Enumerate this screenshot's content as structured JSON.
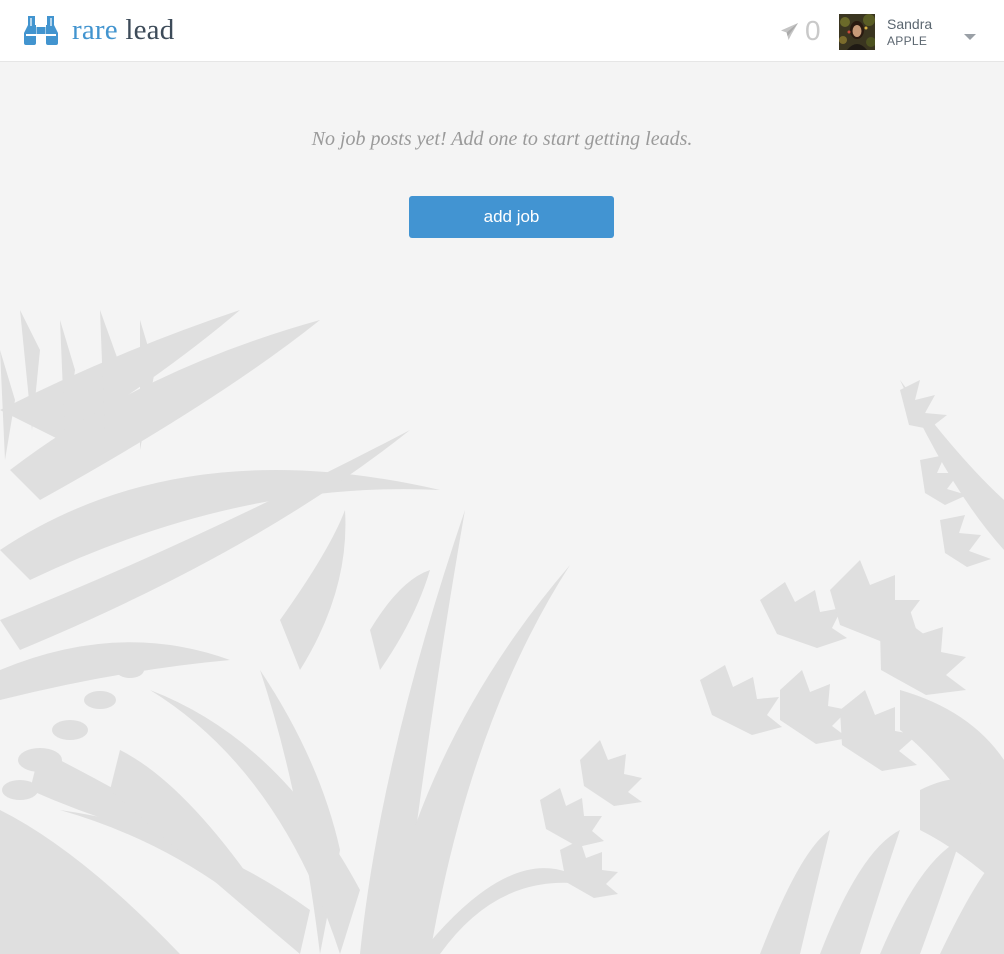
{
  "brand": {
    "name_part1": "rare",
    "name_part2": "lead",
    "icon": "binoculars-icon",
    "accent_color": "#4294cf"
  },
  "header": {
    "sent_icon": "paper-plane-icon",
    "sent_count": "0"
  },
  "user": {
    "name": "Sandra",
    "organization": "APPLE",
    "avatar": "avatar-photo",
    "menu_icon": "chevron-down-icon"
  },
  "main": {
    "empty_message": "No job posts yet! Add one to start getting leads.",
    "add_job_label": "add job",
    "button_color": "#4294d2"
  },
  "background": {
    "illustration": "tropical-foliage-silhouette"
  }
}
